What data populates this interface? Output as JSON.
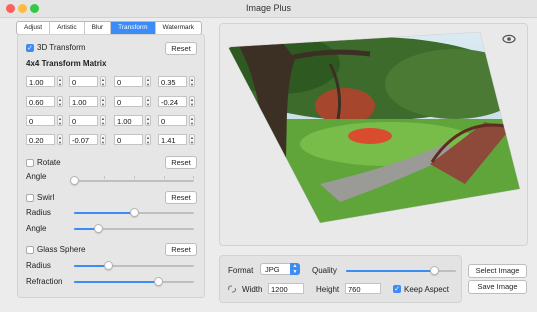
{
  "window": {
    "title": "Image Plus"
  },
  "tabs": [
    {
      "label": "Adjust",
      "active": false
    },
    {
      "label": "Artistic",
      "active": false
    },
    {
      "label": "Blur",
      "active": false
    },
    {
      "label": "Transform",
      "active": true
    },
    {
      "label": "Watermark",
      "active": false
    }
  ],
  "transform3d": {
    "label": "3D Transform",
    "checked": true,
    "reset_label": "Reset",
    "matrix_label": "4x4 Transform Matrix",
    "matrix": [
      [
        "1.00",
        "0",
        "0",
        "0.35"
      ],
      [
        "0.60",
        "1.00",
        "0",
        "-0.24"
      ],
      [
        "0",
        "0",
        "1.00",
        "0"
      ],
      [
        "0.20",
        "-0.07",
        "0",
        "1.41"
      ]
    ]
  },
  "rotate": {
    "label": "Rotate",
    "checked": false,
    "reset_label": "Reset",
    "angle_label": "Angle",
    "angle_value": 0
  },
  "swirl": {
    "label": "Swirl",
    "checked": false,
    "reset_label": "Reset",
    "radius_label": "Radius",
    "radius_value": 0.5,
    "angle_label": "Angle",
    "angle_value": 0.2
  },
  "glass": {
    "label": "Glass Sphere",
    "checked": false,
    "reset_label": "Reset",
    "radius_label": "Radius",
    "radius_value": 0.28,
    "refraction_label": "Refraction",
    "refraction_value": 0.7
  },
  "preview": {
    "eye_icon": "eye-icon",
    "image": "park path with tree and wooden bridge, perspective-transformed"
  },
  "output": {
    "format_label": "Format",
    "format_value": "JPG",
    "quality_label": "Quality",
    "quality_value": 0.8,
    "width_label": "Width",
    "width_value": "1200",
    "height_label": "Height",
    "height_value": "760",
    "keep_aspect_label": "Keep Aspect",
    "keep_aspect_checked": true,
    "link_icon": "link-icon"
  },
  "actions": {
    "select_label": "Select Image",
    "save_label": "Save Image"
  },
  "colors": {
    "accent": "#3b8cf7",
    "close": "#fc605c",
    "minimize": "#fdbc40",
    "zoom": "#34c84a"
  }
}
